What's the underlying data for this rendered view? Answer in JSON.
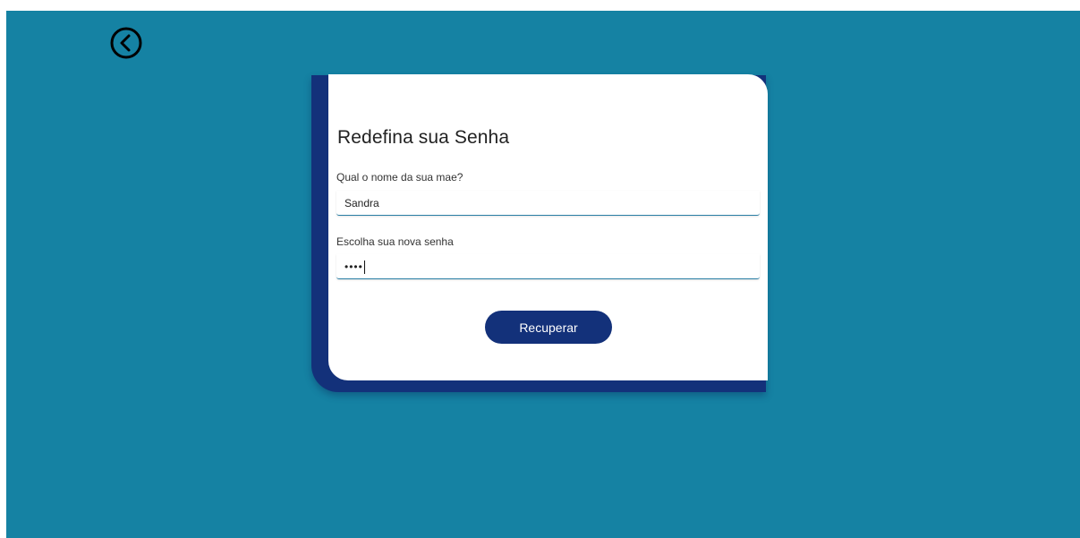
{
  "colors": {
    "background": "#1582a3",
    "card": "#ffffff",
    "accent": "#13317a",
    "input_underline": "#2a7fa5"
  },
  "nav": {
    "back_icon": "chevron-left-circle-icon"
  },
  "form": {
    "title": "Redefina sua Senha",
    "question_label": "Qual o nome da sua mae?",
    "question_value": "Sandra",
    "password_label": "Escolha sua nova senha",
    "password_value": "••••",
    "submit_label": "Recuperar"
  }
}
